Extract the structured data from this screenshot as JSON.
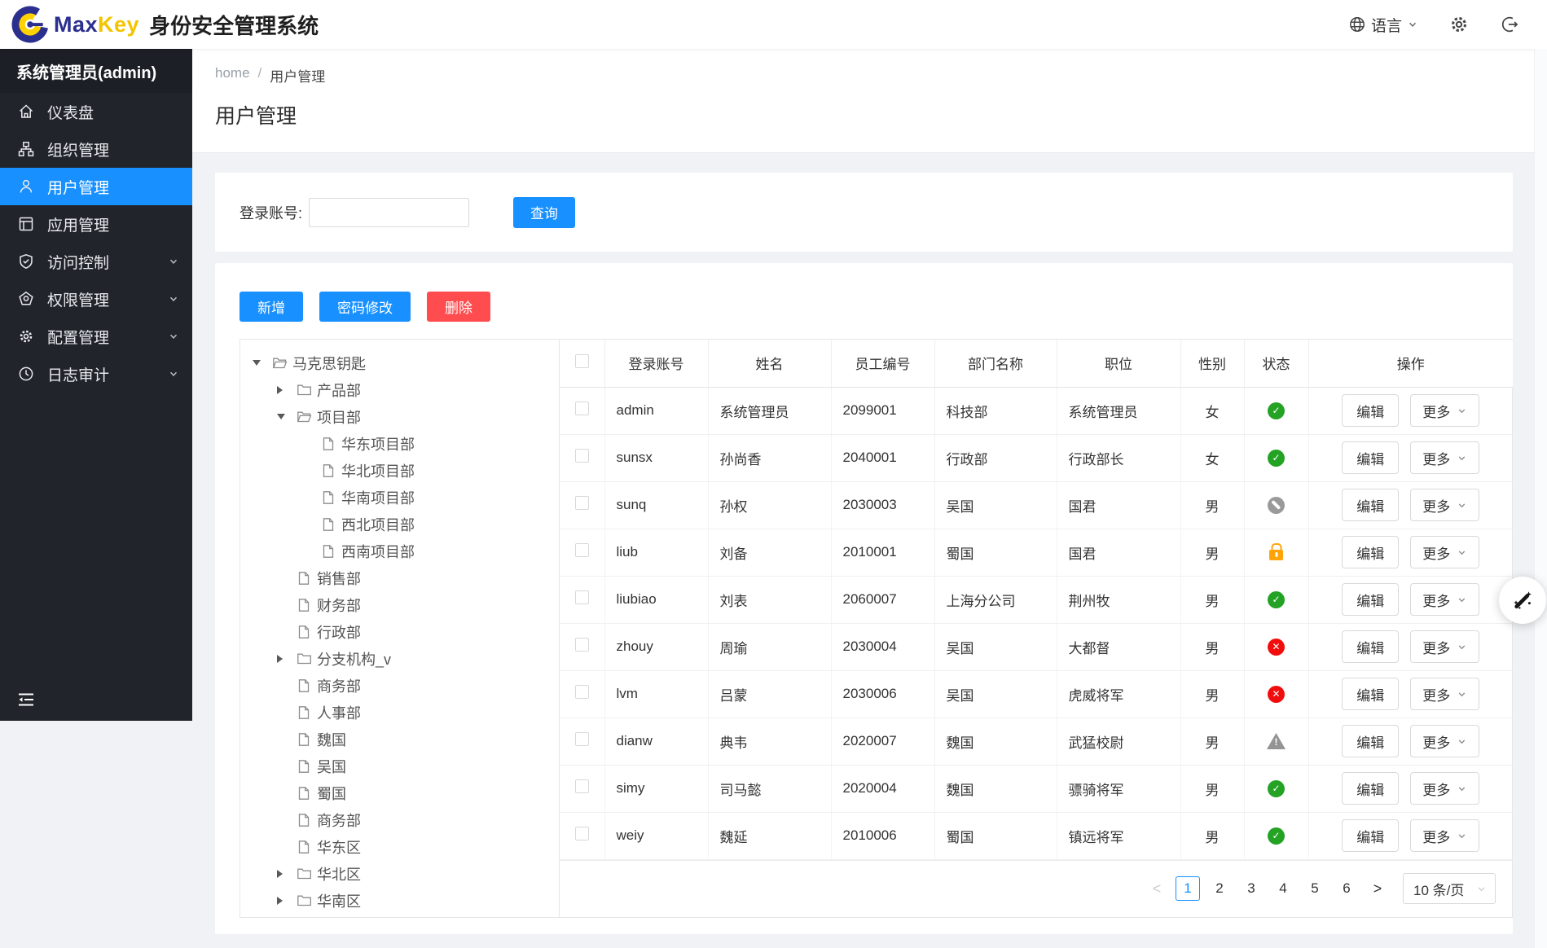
{
  "header": {
    "brand_max": "Max",
    "brand_key": "Key",
    "app_title": "身份安全管理系统",
    "language_label": "语言"
  },
  "sidebar": {
    "user_label": "系统管理员(admin)",
    "items": [
      {
        "id": "dashboard",
        "icon": "dashboard-icon",
        "label": "仪表盘",
        "active": false,
        "expandable": false
      },
      {
        "id": "org",
        "icon": "org-icon",
        "label": "组织管理",
        "active": false,
        "expandable": false
      },
      {
        "id": "user",
        "icon": "user-icon",
        "label": "用户管理",
        "active": true,
        "expandable": false
      },
      {
        "id": "app",
        "icon": "app-icon",
        "label": "应用管理",
        "active": false,
        "expandable": false
      },
      {
        "id": "access",
        "icon": "shield-icon",
        "label": "访问控制",
        "active": false,
        "expandable": true
      },
      {
        "id": "permission",
        "icon": "permission-icon",
        "label": "权限管理",
        "active": false,
        "expandable": true
      },
      {
        "id": "config",
        "icon": "config-gear-icon",
        "label": "配置管理",
        "active": false,
        "expandable": true
      },
      {
        "id": "audit",
        "icon": "audit-clock-icon",
        "label": "日志审计",
        "active": false,
        "expandable": true
      }
    ]
  },
  "breadcrumb": {
    "home": "home",
    "separator": "/",
    "current": "用户管理"
  },
  "page": {
    "title": "用户管理"
  },
  "search": {
    "field_label": "登录账号:",
    "value": "",
    "query_label": "查询"
  },
  "toolbar": {
    "add_label": "新增",
    "password_label": "密码修改",
    "delete_label": "删除"
  },
  "tree": {
    "items": [
      {
        "label": "马克思钥匙",
        "level": 0,
        "node": "branch-open"
      },
      {
        "label": "产品部",
        "level": 1,
        "node": "branch-closed"
      },
      {
        "label": "项目部",
        "level": 1,
        "node": "branch-open"
      },
      {
        "label": "华东项目部",
        "level": 2,
        "node": "leaf"
      },
      {
        "label": "华北项目部",
        "level": 2,
        "node": "leaf"
      },
      {
        "label": "华南项目部",
        "level": 2,
        "node": "leaf"
      },
      {
        "label": "西北项目部",
        "level": 2,
        "node": "leaf"
      },
      {
        "label": "西南项目部",
        "level": 2,
        "node": "leaf"
      },
      {
        "label": "销售部",
        "level": 1,
        "node": "leaf"
      },
      {
        "label": "财务部",
        "level": 1,
        "node": "leaf"
      },
      {
        "label": "行政部",
        "level": 1,
        "node": "leaf"
      },
      {
        "label": "分支机构_v",
        "level": 1,
        "node": "branch-closed"
      },
      {
        "label": "商务部",
        "level": 1,
        "node": "leaf"
      },
      {
        "label": "人事部",
        "level": 1,
        "node": "leaf"
      },
      {
        "label": "魏国",
        "level": 1,
        "node": "leaf"
      },
      {
        "label": "吴国",
        "level": 1,
        "node": "leaf"
      },
      {
        "label": "蜀国",
        "level": 1,
        "node": "leaf"
      },
      {
        "label": "商务部",
        "level": 1,
        "node": "leaf"
      },
      {
        "label": "华东区",
        "level": 1,
        "node": "leaf"
      },
      {
        "label": "华北区",
        "level": 1,
        "node": "branch-closed"
      },
      {
        "label": "华南区",
        "level": 1,
        "node": "branch-closed"
      }
    ]
  },
  "table": {
    "headers": [
      "登录账号",
      "姓名",
      "员工编号",
      "部门名称",
      "职位",
      "性别",
      "状态",
      "操作"
    ],
    "edit_label": "编辑",
    "more_label": "更多",
    "rows": [
      {
        "account": "admin",
        "name": "系统管理员",
        "employee_no": "2099001",
        "department": "科技部",
        "position": "系统管理员",
        "gender": "女",
        "status": "active"
      },
      {
        "account": "sunsx",
        "name": "孙尚香",
        "employee_no": "2040001",
        "department": "行政部",
        "position": "行政部长",
        "gender": "女",
        "status": "active"
      },
      {
        "account": "sunq",
        "name": "孙权",
        "employee_no": "2030003",
        "department": "吴国",
        "position": "国君",
        "gender": "男",
        "status": "disabled"
      },
      {
        "account": "liub",
        "name": "刘备",
        "employee_no": "2010001",
        "department": "蜀国",
        "position": "国君",
        "gender": "男",
        "status": "locked"
      },
      {
        "account": "liubiao",
        "name": "刘表",
        "employee_no": "2060007",
        "department": "上海分公司",
        "position": "荆州牧",
        "gender": "男",
        "status": "active"
      },
      {
        "account": "zhouy",
        "name": "周瑜",
        "employee_no": "2030004",
        "department": "吴国",
        "position": "大都督",
        "gender": "男",
        "status": "inactive"
      },
      {
        "account": "lvm",
        "name": "吕蒙",
        "employee_no": "2030006",
        "department": "吴国",
        "position": "虎威将军",
        "gender": "男",
        "status": "inactive"
      },
      {
        "account": "dianw",
        "name": "典韦",
        "employee_no": "2020007",
        "department": "魏国",
        "position": "武猛校尉",
        "gender": "男",
        "status": "warning"
      },
      {
        "account": "simy",
        "name": "司马懿",
        "employee_no": "2020004",
        "department": "魏国",
        "position": "骠骑将军",
        "gender": "男",
        "status": "active"
      },
      {
        "account": "weiy",
        "name": "魏延",
        "employee_no": "2010006",
        "department": "蜀国",
        "position": "镇远将军",
        "gender": "男",
        "status": "active"
      }
    ]
  },
  "pagination": {
    "prev_icon": "<",
    "next_icon": ">",
    "pages": [
      "1",
      "2",
      "3",
      "4",
      "5",
      "6"
    ],
    "active_page": "1",
    "page_size_label": "10 条/页"
  },
  "colors": {
    "primary": "#1890ff",
    "danger": "#ff4d4f",
    "status_active": "#23a223",
    "status_inactive": "#f20d0d",
    "status_locked": "#ffa408",
    "status_disabled": "#9a9a9a",
    "status_warning": "#949494",
    "sidebar_bg": "#21252b"
  }
}
